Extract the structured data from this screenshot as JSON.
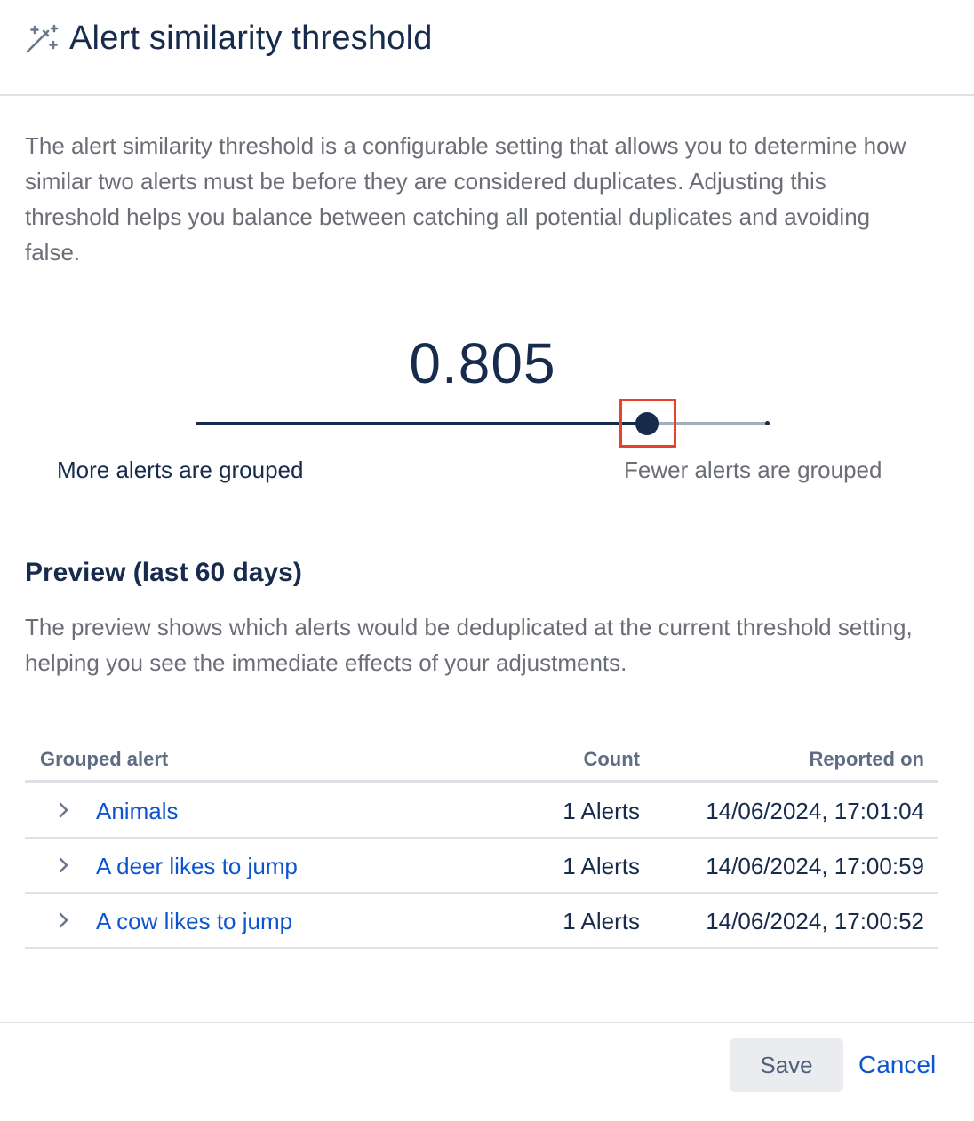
{
  "header": {
    "title": "Alert similarity threshold",
    "icon": "magic-wand-icon"
  },
  "description": "The alert similarity threshold is a configurable setting that allows you to determine how similar two alerts must be before they are considered duplicates. Adjusting this threshold helps you balance between catching all potential duplicates and avoiding false.",
  "threshold": {
    "value_label": "0.805",
    "value": 0.805,
    "left_label": "More alerts are grouped",
    "right_label": "Fewer alerts are grouped"
  },
  "preview": {
    "title": "Preview (last 60 days)",
    "description": "The preview shows which alerts would be deduplicated at the current threshold setting, helping you see the immediate effects of your adjustments.",
    "columns": {
      "grouped_alert": "Grouped alert",
      "count": "Count",
      "reported_on": "Reported on"
    },
    "rows": [
      {
        "name": "Animals",
        "count": "1 Alerts",
        "reported_on": "14/06/2024, 17:01:04"
      },
      {
        "name": "A deer likes to jump",
        "count": "1 Alerts",
        "reported_on": "14/06/2024, 17:00:59"
      },
      {
        "name": "A cow likes to jump",
        "count": "1 Alerts",
        "reported_on": "14/06/2024, 17:00:52"
      }
    ]
  },
  "footer": {
    "save_label": "Save",
    "cancel_label": "Cancel"
  },
  "colors": {
    "primary": "#172b4d",
    "link": "#0c55cf",
    "muted": "#6b6e76",
    "focus": "#e8412c"
  }
}
